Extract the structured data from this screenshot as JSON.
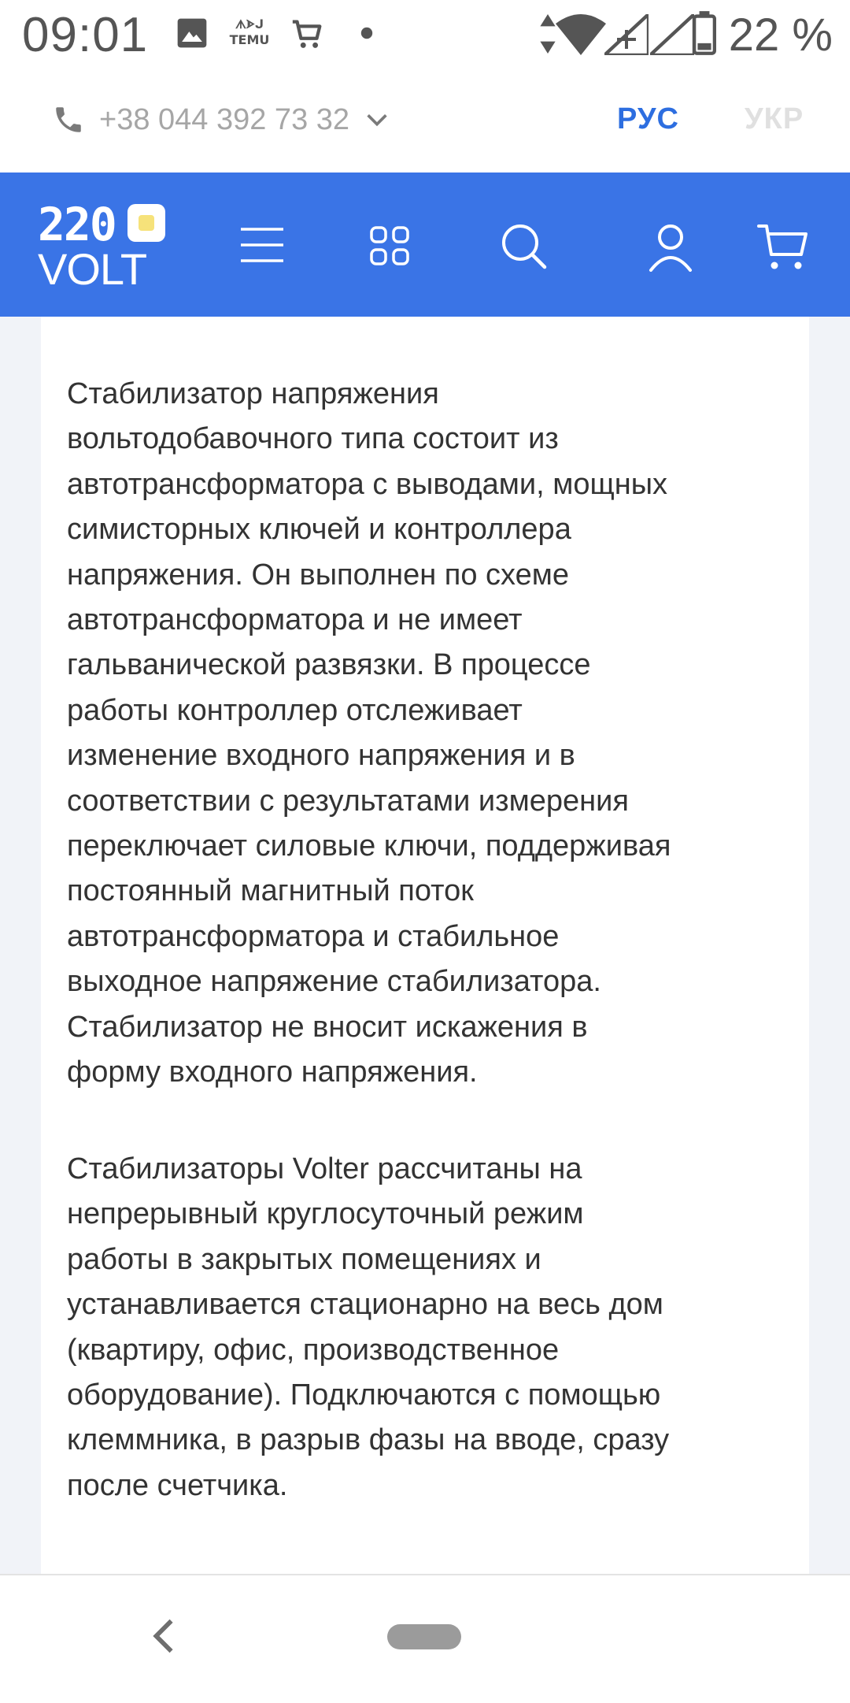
{
  "status_bar": {
    "time": "09:01",
    "battery_percent": "22 %",
    "temu_label_top": "ᗑᗍᒍ",
    "temu_label": "TEMU"
  },
  "topbar": {
    "phone": "+38 044 392 73 32",
    "lang_ru": "РУС",
    "lang_ua": "УКР"
  },
  "header": {
    "logo_top": "220",
    "logo_bottom": "VOLT"
  },
  "content": {
    "paragraph1": "Стабилизатор напряжения\nвольтодобавочного типа состоит из\nавтотрансформатора с выводами, мощных\nсимисторных ключей и контроллера\nнапряжения. Он выполнен по схеме\nавтотрансформатора и не имеет\nгальванической развязки. В процессе\nработы контроллер отслеживает\nизменение входного напряжения и в\nсоответствии с результатами измерения\nпереключает силовые ключи, поддерживая\nпостоянный магнитный поток\nавтотрансформатора и стабильное\nвыходное напряжение стабилизатора.\nСтабилизатор не вносит искажения в\nформу входного напряжения.",
    "paragraph2": "Стабилизаторы Volter рассчитаны на\nнепрерывный круглосуточный режим\nработы в закрытых  помещениях и\nустанавливается стационарно на весь дом\n(квартиру, офис, производственное\nоборудование). Подключаются с помощью\nклеммника, в разрыв фазы на вводе, сразу\nпосле счетчика."
  },
  "colors": {
    "brand_blue": "#3a74e6",
    "lang_active": "#2d6ee0",
    "lang_inactive": "#e0e0e0",
    "logo_yellow": "#f6e27a"
  },
  "icons": {
    "status": [
      "gallery-icon",
      "temu-icon",
      "cart-icon",
      "dot-icon",
      "data-arrows-icon",
      "wifi-icon",
      "signal-icon",
      "signal-icon-2",
      "battery-icon"
    ],
    "header": [
      "menu-icon",
      "catalog-grid-icon",
      "search-icon",
      "user-icon",
      "cart-icon"
    ],
    "nav": [
      "back-icon",
      "home-pill"
    ]
  }
}
